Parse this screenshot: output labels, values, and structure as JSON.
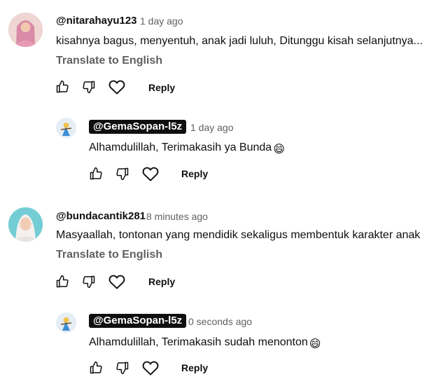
{
  "comments": [
    {
      "author": "@nitarahayu123",
      "time": "1 day ago",
      "text": "kisahnya bagus, menyentuh, anak jadi luluh, Ditunggu kisah selanjutnya...",
      "translate": "Translate to English",
      "reply_label": "Reply",
      "reply": {
        "author": "@GemaSopan-l5z",
        "time": "1 day ago",
        "text": "Alhamdulillah, Terimakasih ya Bunda",
        "emoji": "😄",
        "reply_label": "Reply"
      }
    },
    {
      "author": "@bundacantik281",
      "time": "8 minutes ago",
      "text": "Masyaallah,  tontonan yang mendidik sekaligus membentuk karakter anak",
      "translate": "Translate to English",
      "reply_label": "Reply",
      "reply": {
        "author": "@GemaSopan-l5z",
        "time": "0 seconds ago",
        "text": "Alhamdulillah, Terimakasih sudah menonton",
        "emoji": "😄",
        "reply_label": "Reply"
      }
    }
  ]
}
